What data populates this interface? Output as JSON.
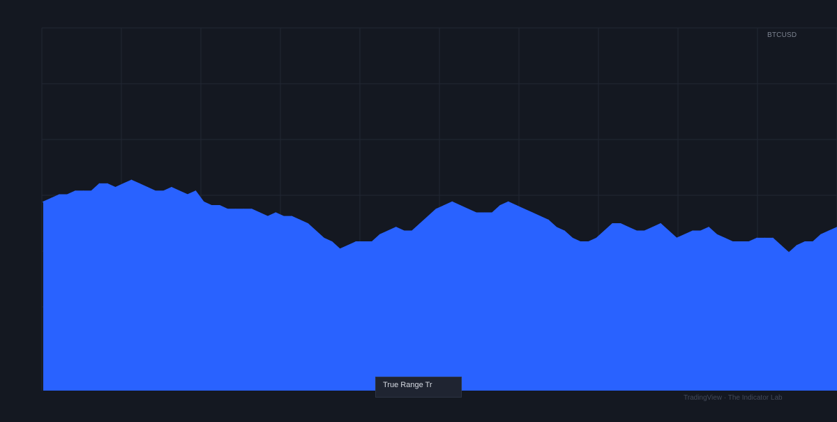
{
  "header": {
    "symbol": "BTCUSD"
  },
  "legend": {
    "label": "True Range Tr"
  },
  "footer": {
    "watermark": "TradingView · The Indicator Lab"
  },
  "colors": {
    "background": "#141821",
    "grid": "#222734",
    "area_fill": "#2962ff",
    "area_line": "#2962ff"
  },
  "chart_data": {
    "type": "area",
    "grid": true,
    "vertical_gridlines": 10,
    "horizontal_gridlines": 6,
    "x_range": [
      0,
      100
    ],
    "ylim": [
      0,
      100
    ],
    "series": [
      {
        "values": [
          52,
          53,
          54,
          54,
          55,
          55,
          55,
          57,
          57,
          56,
          57,
          58,
          57,
          56,
          55,
          55,
          56,
          55,
          54,
          55,
          52,
          51,
          51,
          50,
          50,
          50,
          50,
          49,
          48,
          49,
          48,
          48,
          47,
          46,
          44,
          42,
          41,
          39,
          40,
          41,
          41,
          41,
          43,
          44,
          45,
          44,
          44,
          46,
          48,
          50,
          51,
          52,
          51,
          50,
          49,
          49,
          49,
          51,
          52,
          51,
          50,
          49,
          48,
          47,
          45,
          44,
          42,
          41,
          41,
          42,
          44,
          46,
          46,
          45,
          44,
          44,
          45,
          46,
          44,
          42,
          43,
          44,
          44,
          45,
          43,
          42,
          41,
          41,
          41,
          42,
          42,
          42,
          40,
          38,
          40,
          41,
          41,
          43,
          44,
          45
        ]
      }
    ]
  }
}
